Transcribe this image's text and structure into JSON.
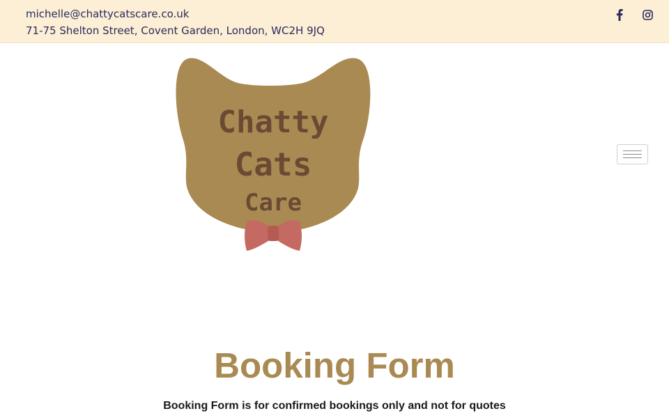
{
  "topbar": {
    "email": "michelle@chattycatscare.co.uk",
    "address": "71-75 Shelton Street, Covent Garden, London, WC2H 9JQ",
    "social": [
      {
        "icon": "facebook-icon"
      },
      {
        "icon": "instagram-icon"
      }
    ],
    "text_color": "#2b2b5c",
    "background": "#fcefd6"
  },
  "logo": {
    "lines": [
      "Chatty",
      "Cats",
      "Care"
    ],
    "head_color": "#a98a53",
    "text_color": "#6b4a33",
    "bowtie_color": "#c56a62"
  },
  "nav": {
    "menu_icon": "hamburger-menu-icon"
  },
  "main": {
    "title": "Booking Form",
    "notice": "Booking Form is for confirmed bookings only and not for quotes",
    "title_color": "#a98a53"
  }
}
